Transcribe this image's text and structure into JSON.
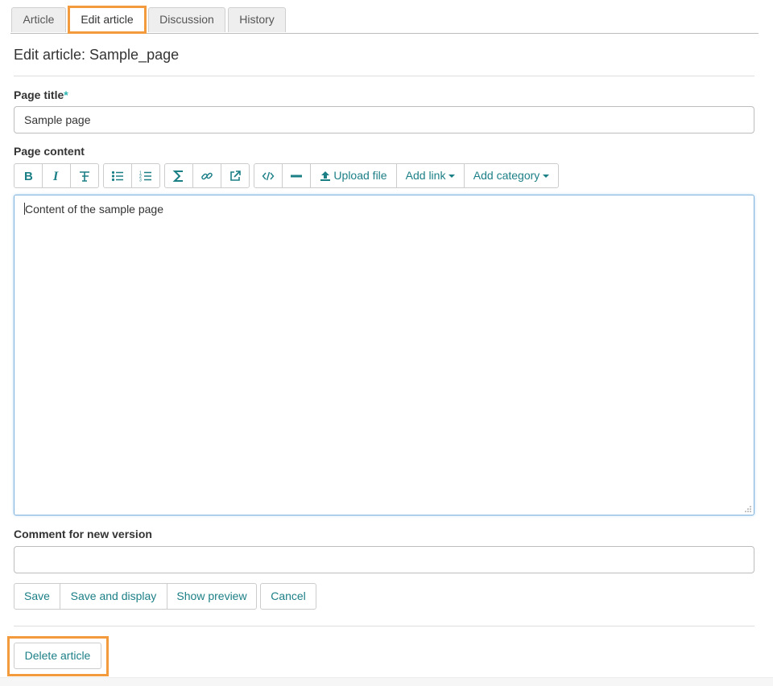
{
  "tabs": [
    {
      "label": "Article"
    },
    {
      "label": "Edit article"
    },
    {
      "label": "Discussion"
    },
    {
      "label": "History"
    }
  ],
  "page_title": "Edit article: Sample_page",
  "form": {
    "title_label": "Page title",
    "required_mark": "*",
    "title_value": "Sample page",
    "content_label": "Page content",
    "content_value": "Content of the sample page",
    "comment_label": "Comment for new version",
    "comment_value": ""
  },
  "toolbar": {
    "icons": [
      "bold-icon",
      "italic-icon",
      "heading-icon",
      "bullet-list-icon",
      "numbered-list-icon",
      "sum-icon",
      "link-icon",
      "external-link-icon",
      "code-icon",
      "horizontal-rule-icon",
      "upload-icon",
      "caret-down-icon"
    ],
    "upload_label": "Upload file",
    "add_link_label": "Add link",
    "add_category_label": "Add category"
  },
  "actions": {
    "save": "Save",
    "save_display": "Save and display",
    "preview": "Show preview",
    "cancel": "Cancel",
    "delete": "Delete article"
  },
  "colors": {
    "accent": "#1b7f86",
    "highlight": "#f39a3c",
    "required": "#2bb5b0"
  }
}
